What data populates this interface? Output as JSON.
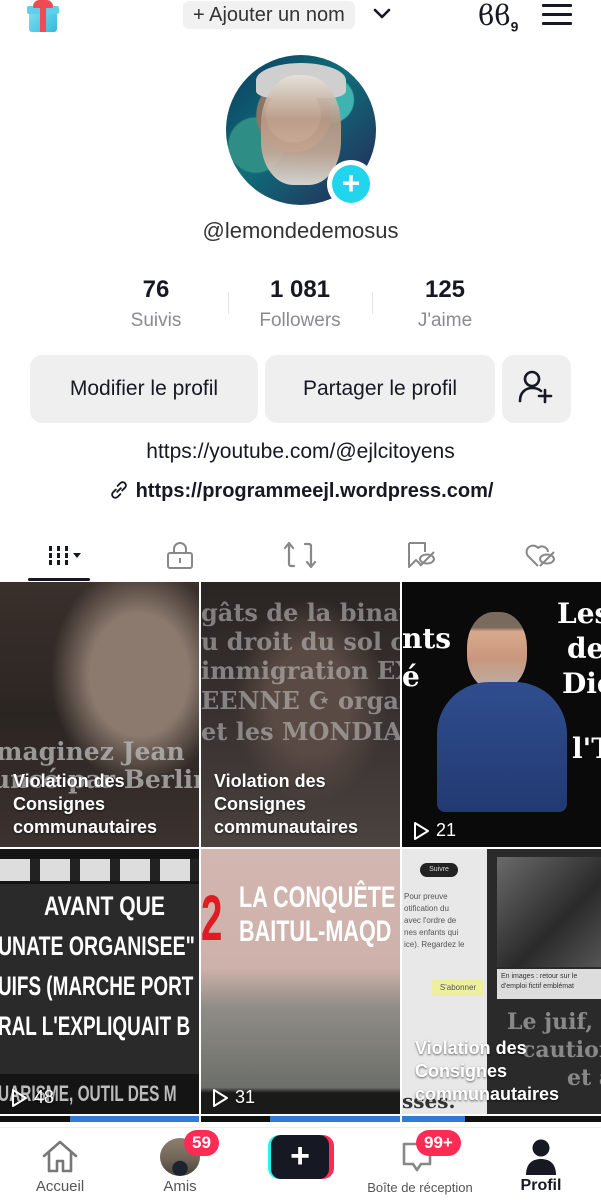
{
  "topbar": {
    "add_name_label": "+ Ajouter un nom",
    "footprint_icon_text": "ϐϐ",
    "footprint_count": "9"
  },
  "profile": {
    "username": "@lemondedemosus"
  },
  "stats": [
    {
      "value": "76",
      "label": "Suivis"
    },
    {
      "value": "1 081",
      "label": "Followers"
    },
    {
      "value": "125",
      "label": "J'aime"
    }
  ],
  "actions": {
    "edit_profile": "Modifier le profil",
    "share_profile": "Partager le profil"
  },
  "bio": {
    "line1": "https://youtube.com/@ejlcitoyens",
    "link": "https://programmeejl.wordpress.com/"
  },
  "tabs": [
    {
      "name": "videos",
      "icon": "grid-icon",
      "active": true
    },
    {
      "name": "private",
      "icon": "lock-icon"
    },
    {
      "name": "reposts",
      "icon": "repost-icon"
    },
    {
      "name": "favorites",
      "icon": "bookmark-hidden-icon"
    },
    {
      "name": "liked",
      "icon": "heart-hidden-icon"
    }
  ],
  "videos": [
    {
      "overlay_text": [
        "maginez Jean",
        "uncé par Berlin"
      ],
      "status": "Violation des\nConsignes\ncommunautaires"
    },
    {
      "overlay_text": [
        "gâts de la binatio",
        "u droit du sol coué",
        "immigration EXTR",
        "EENNE ☪ organi",
        "et les MONDIALIS"
      ],
      "status": "Violation des\nConsignes\ncommunautaires"
    },
    {
      "overlay_text": [
        "nts",
        "é",
        "Les",
        "de",
        "Die",
        "l'T"
      ],
      "plays": "21"
    },
    {
      "overlay_text": [
        "AVANT QUE",
        "UNATE ORGANISEE\"",
        "UIFS (MARCHE PORT",
        "RAL L'EXPLIQUAIT B",
        "UARISME, OUTIL DES M"
      ],
      "plays": "48"
    },
    {
      "overlay_text": [
        "2",
        "LA CONQUÊTE",
        "BAITUL-MAQD"
      ],
      "plays": "31"
    },
    {
      "overlay_text": [
        "Suivre",
        "Pour preuve",
        "otification du",
        "avec l'ordre de",
        "nes enfants qui",
        "ice). Regardez le",
        "S'abonner",
        "En images : retour sur le",
        "d'emploi fictif emblémat",
        "Le juif,",
        "caution",
        "et a",
        "sses."
      ],
      "status": "Violation des\nConsignes\ncommunautaires"
    }
  ],
  "bottom_nav": {
    "home": "Accueil",
    "friends": "Amis",
    "friends_badge": "59",
    "create": "+",
    "inbox": "Boîte de réception",
    "inbox_badge": "99+",
    "profile": "Profil"
  },
  "colors": {
    "accent_cyan": "#20d5ec",
    "accent_red": "#fe2c55",
    "text_primary": "#161823",
    "text_secondary": "#8a8b91",
    "button_bg": "#efeff0"
  }
}
